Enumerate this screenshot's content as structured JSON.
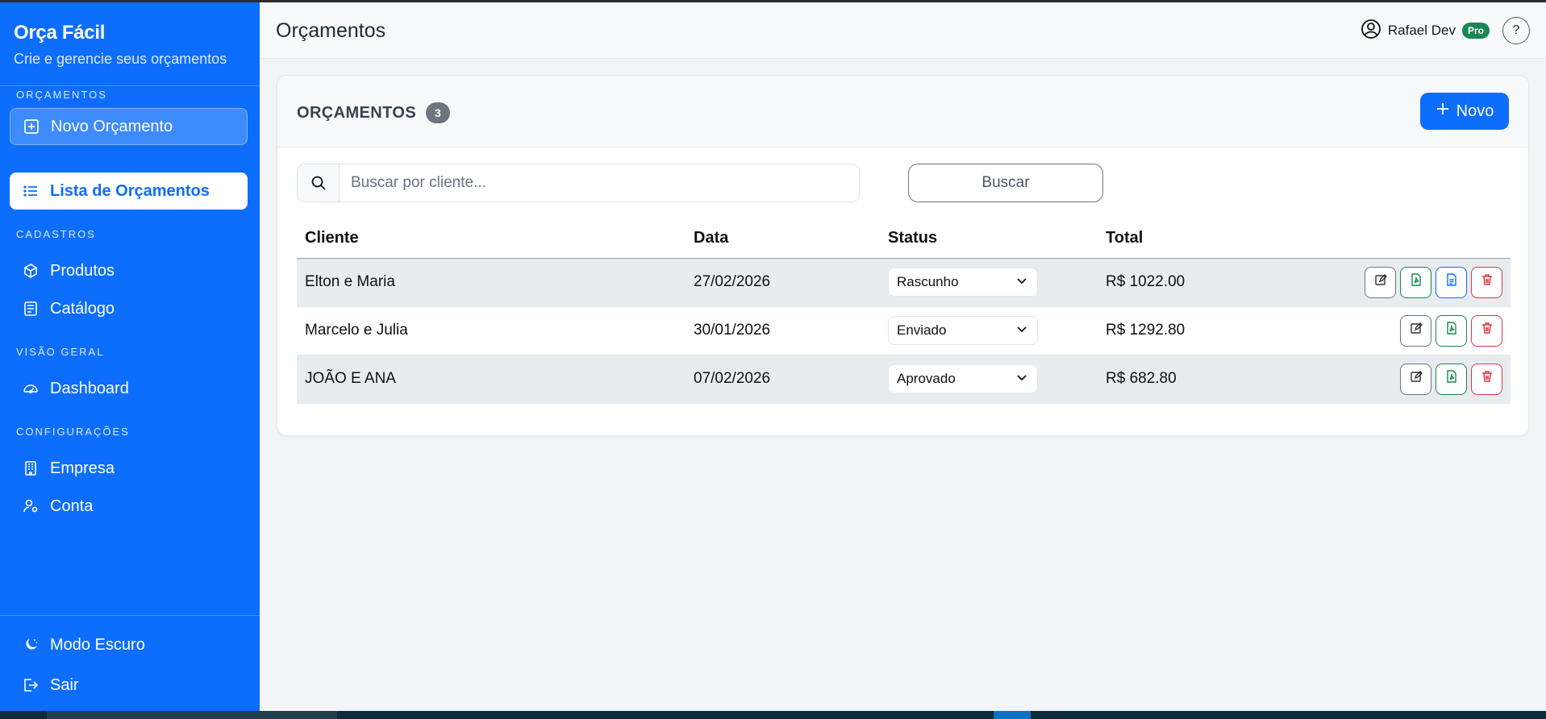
{
  "sidebar": {
    "brand_title": "Orça Fácil",
    "brand_subtitle": "Crie e gerencie seus orçamentos",
    "sections": {
      "orcamentos": "ORÇAMENTOS",
      "cadastros": "CADASTROS",
      "visao_geral": "VISÃO GERAL",
      "configuracoes": "CONFIGURAÇÕES"
    },
    "items": {
      "novo_orcamento": "Novo Orçamento",
      "lista_orcamentos": "Lista de Orçamentos",
      "produtos": "Produtos",
      "catalogo": "Catálogo",
      "dashboard": "Dashboard",
      "empresa": "Empresa",
      "conta": "Conta",
      "modo_escuro": "Modo Escuro",
      "sair": "Sair"
    }
  },
  "header": {
    "title": "Orçamentos",
    "user_name": "Rafael Dev",
    "plan_badge": "Pro",
    "help": "?"
  },
  "card": {
    "title": "ORÇAMENTOS",
    "count": "3",
    "new_button": "Novo",
    "search_placeholder": "Buscar por cliente...",
    "search_button": "Buscar"
  },
  "table": {
    "columns": [
      "Cliente",
      "Data",
      "Status",
      "Total"
    ],
    "rows": [
      {
        "cliente": "Elton e Maria",
        "data": "27/02/2026",
        "status": "Rascunho",
        "total": "R$ 1022.00"
      },
      {
        "cliente": "Marcelo e Julia",
        "data": "30/01/2026",
        "status": "Enviado",
        "total": "R$ 1292.80"
      },
      {
        "cliente": "JOÃO E ANA",
        "data": "07/02/2026",
        "status": "Aprovado",
        "total": "R$ 682.80"
      }
    ]
  },
  "colors": {
    "primary": "#0d6efd",
    "success": "#198754",
    "danger": "#dc3545",
    "secondary": "#6c757d"
  }
}
